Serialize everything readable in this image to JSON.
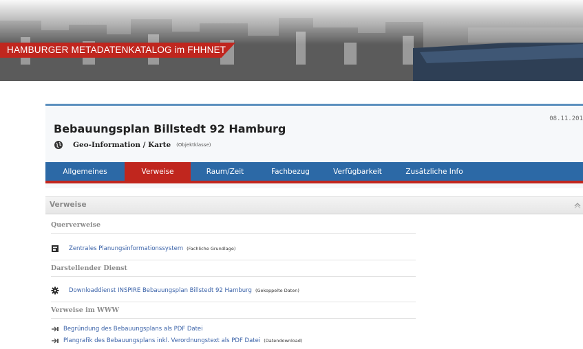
{
  "banner": {
    "title": "HAMBURGER METADATENKATALOG im FHHNET"
  },
  "record": {
    "date": "08.11.201",
    "title": "Bebauungsplan Billstedt 92 Hamburg",
    "class_label": "Geo-Information / Karte",
    "class_note": "(Objektklasse)",
    "class_icon": "globe-icon"
  },
  "tabs": [
    {
      "label": "Allgemeines",
      "active": false
    },
    {
      "label": "Verweise",
      "active": true
    },
    {
      "label": "Raum/Zeit",
      "active": false
    },
    {
      "label": "Fachbezug",
      "active": false
    },
    {
      "label": "Verfügbarkeit",
      "active": false
    },
    {
      "label": "Zusätzliche Info",
      "active": false
    }
  ],
  "section": {
    "title": "Verweise",
    "collapse_icon": "chevron-up-icon"
  },
  "groups": {
    "querverweise": {
      "title": "Querverweise",
      "items": [
        {
          "icon": "map-document-icon",
          "link": "Zentrales Planungsinformationssystem",
          "tag": "(Fachliche Grundlage)"
        }
      ]
    },
    "darstellender": {
      "title": "Darstellender Dienst",
      "items": [
        {
          "icon": "gear-icon",
          "link": "Downloaddienst INSPIRE Bebauungsplan Billstedt 92 Hamburg",
          "tag": "(Gekoppelte Daten)"
        }
      ]
    },
    "www": {
      "title": "Verweise im WWW",
      "items": [
        {
          "icon": "external-link-icon",
          "link": "Begründung des Bebauungsplans als PDF Datei",
          "tag": ""
        },
        {
          "icon": "external-link-icon",
          "link": "Plangrafik des Bebauungsplans inkl. Verordnungstext als PDF Datei",
          "tag": "(Datendownload)"
        }
      ]
    }
  },
  "colors": {
    "accent_red": "#c0261e",
    "tab_blue": "#2c69a6",
    "link_blue": "#3a62a8",
    "panel_border": "#5b8fbe"
  }
}
